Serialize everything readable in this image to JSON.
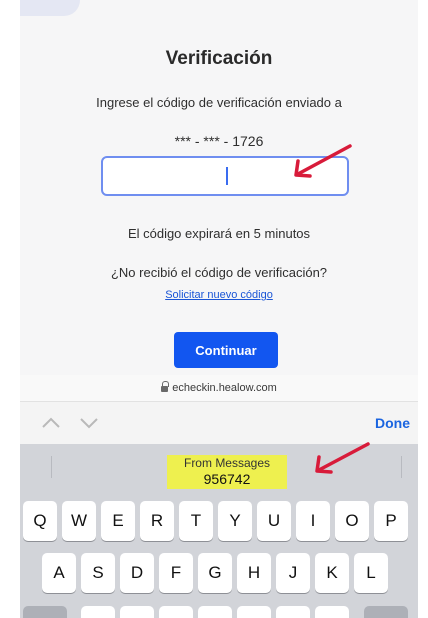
{
  "page": {
    "title": "Verificación",
    "instruction": "Ingrese el código de verificación enviado a",
    "phone_masked": "*** - *** - 1726",
    "code_input_value": "",
    "expires_text": "El código expirará en 5 minutos",
    "no_code_text": "¿No recibió el código de verificación?",
    "resend_link": "Solicitar nuevo código",
    "continue_button": "Continuar"
  },
  "browser": {
    "url": "echeckin.healow.com"
  },
  "keyboard_accessory": {
    "prev_icon": "chevron-up-icon",
    "next_icon": "chevron-down-icon",
    "done_label": "Done"
  },
  "keyboard": {
    "suggestion": {
      "source": "From Messages",
      "code": "956742"
    },
    "rows": [
      [
        "Q",
        "W",
        "E",
        "R",
        "T",
        "Y",
        "U",
        "I",
        "O",
        "P"
      ],
      [
        "A",
        "S",
        "D",
        "F",
        "G",
        "H",
        "J",
        "K",
        "L"
      ]
    ]
  },
  "colors": {
    "annotation_arrow": "#d81b3a",
    "primary_button": "#1256f0",
    "suggestion_highlight": "#eef04f",
    "link": "#1a55d6"
  }
}
